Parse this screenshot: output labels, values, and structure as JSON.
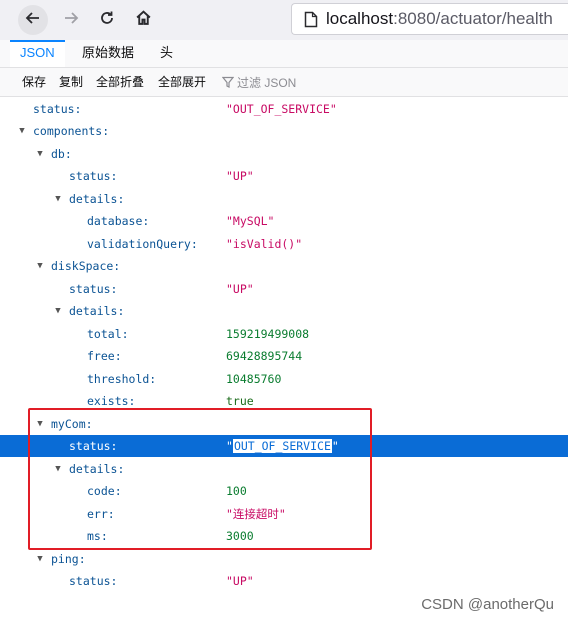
{
  "browser": {
    "url_host": "localhost",
    "url_rest": ":8080/actuator/health"
  },
  "tabs": [
    {
      "label": "JSON",
      "active": true
    },
    {
      "label": "原始数据",
      "active": false
    },
    {
      "label": "头",
      "active": false
    }
  ],
  "toolbar": {
    "save": "保存",
    "copy": "复制",
    "collapse_all": "全部折叠",
    "expand_all": "全部展开",
    "filter": "过滤 JSON"
  },
  "tree": {
    "status_key": "status:",
    "status_val": "\"OUT_OF_SERVICE\"",
    "components_key": "components:",
    "db": {
      "key": "db:",
      "status_key": "status:",
      "status_val": "\"UP\"",
      "details_key": "details:",
      "database_key": "database:",
      "database_val": "\"MySQL\"",
      "validation_key": "validationQuery:",
      "validation_val": "\"isValid()\""
    },
    "disk": {
      "key": "diskSpace:",
      "status_key": "status:",
      "status_val": "\"UP\"",
      "details_key": "details:",
      "total_key": "total:",
      "total_val": "159219499008",
      "free_key": "free:",
      "free_val": "69428895744",
      "threshold_key": "threshold:",
      "threshold_val": "10485760",
      "exists_key": "exists:",
      "exists_val": "true"
    },
    "mycom": {
      "key": "myCom:",
      "status_key": "status:",
      "status_quote": "\"",
      "status_text": "OUT_OF_SERVICE",
      "details_key": "details:",
      "code_key": "code:",
      "code_val": "100",
      "err_key": "err:",
      "err_val": "\"连接超时\"",
      "ms_key": "ms:",
      "ms_val": "3000"
    },
    "ping": {
      "key": "ping:",
      "status_key": "status:",
      "status_val": "\"UP\""
    }
  },
  "watermark": "CSDN @anotherQu",
  "colors": {
    "accent": "#0a84ff",
    "selection": "#0a6cd6",
    "string": "#c80b64",
    "number": "#0a7c2f",
    "highlight_box": "#e11d26"
  }
}
